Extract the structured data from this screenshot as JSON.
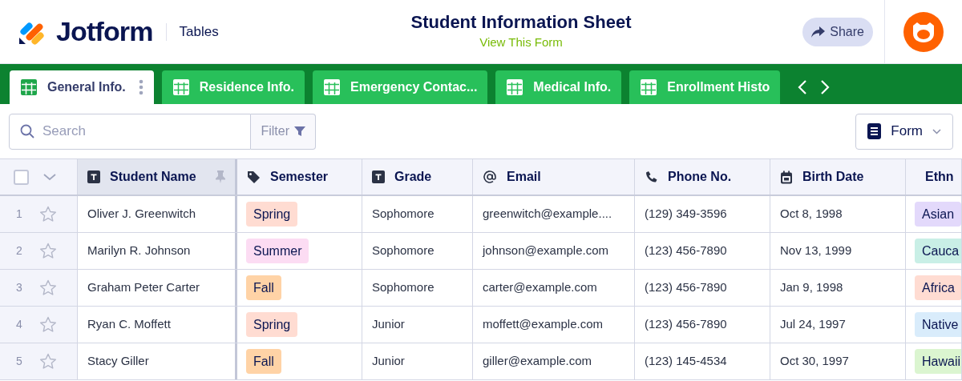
{
  "header": {
    "brand": "Jotform",
    "product": "Tables",
    "title": "Student Information Sheet",
    "subtitle": "View This Form",
    "share": "Share"
  },
  "tabs": [
    {
      "label": "General Info.",
      "selected": true
    },
    {
      "label": "Residence Info.",
      "selected": false
    },
    {
      "label": "Emergency Contac...",
      "selected": false
    },
    {
      "label": "Medical Info.",
      "selected": false
    },
    {
      "label": "Enrollment Histo",
      "selected": false
    }
  ],
  "toolbar": {
    "search": {
      "placeholder": "Search"
    },
    "filter": "Filter",
    "view": "Form"
  },
  "table": {
    "select_all": {
      "checked": false
    },
    "columns": [
      {
        "label": "Student Name",
        "kind": "text",
        "pinned": true
      },
      {
        "label": "Semester",
        "kind": "tag",
        "pinned": false
      },
      {
        "label": "Grade",
        "kind": "text",
        "pinned": false
      },
      {
        "label": "Email",
        "kind": "email",
        "pinned": false
      },
      {
        "label": "Phone No.",
        "kind": "phone",
        "pinned": false
      },
      {
        "label": "Birth Date",
        "kind": "date",
        "pinned": false
      },
      {
        "label": "Ethn",
        "kind": "tag",
        "pinned": false
      }
    ],
    "rows": [
      {
        "index": "1",
        "cells": [
          {
            "text": "Oliver J. Greenwitch"
          },
          {
            "text": "Spring",
            "color": "#ffdcd2"
          },
          {
            "text": "Sophomore"
          },
          {
            "text": "greenwitch@example...."
          },
          {
            "text": "(129) 349-3596"
          },
          {
            "text": "Oct 8, 1998"
          },
          {
            "text": "Asian",
            "color": "#e3d9fb"
          }
        ]
      },
      {
        "index": "2",
        "cells": [
          {
            "text": "Marilyn R. Johnson"
          },
          {
            "text": "Summer",
            "color": "#fcdcf3"
          },
          {
            "text": "Sophomore"
          },
          {
            "text": "johnson@example.com"
          },
          {
            "text": "(123) 456-7890"
          },
          {
            "text": "Nov 13, 1999"
          },
          {
            "text": "Cauca",
            "color": "#c9efe6"
          }
        ]
      },
      {
        "index": "3",
        "cells": [
          {
            "text": "Graham Peter Carter"
          },
          {
            "text": "Fall",
            "color": "#ffd3a6"
          },
          {
            "text": "Sophomore"
          },
          {
            "text": "carter@example.com"
          },
          {
            "text": "(123) 456-7890"
          },
          {
            "text": "Jan 9, 1998"
          },
          {
            "text": "Africa",
            "color": "#ffdcd2"
          }
        ]
      },
      {
        "index": "4",
        "cells": [
          {
            "text": "Ryan C. Moffett"
          },
          {
            "text": "Spring",
            "color": "#ffdcd2"
          },
          {
            "text": "Junior"
          },
          {
            "text": "moffett@example.com"
          },
          {
            "text": "(123) 456-7890"
          },
          {
            "text": "Jul 24, 1997"
          },
          {
            "text": "Native",
            "color": "#d9ecfb"
          }
        ]
      },
      {
        "index": "5",
        "cells": [
          {
            "text": "Stacy Giller"
          },
          {
            "text": "Fall",
            "color": "#ffd3a6"
          },
          {
            "text": "Junior"
          },
          {
            "text": "giller@example.com"
          },
          {
            "text": "(123) 145-4534"
          },
          {
            "text": "Oct 30, 1997"
          },
          {
            "text": "Hawaii",
            "color": "#dbf5d0"
          }
        ]
      }
    ]
  }
}
